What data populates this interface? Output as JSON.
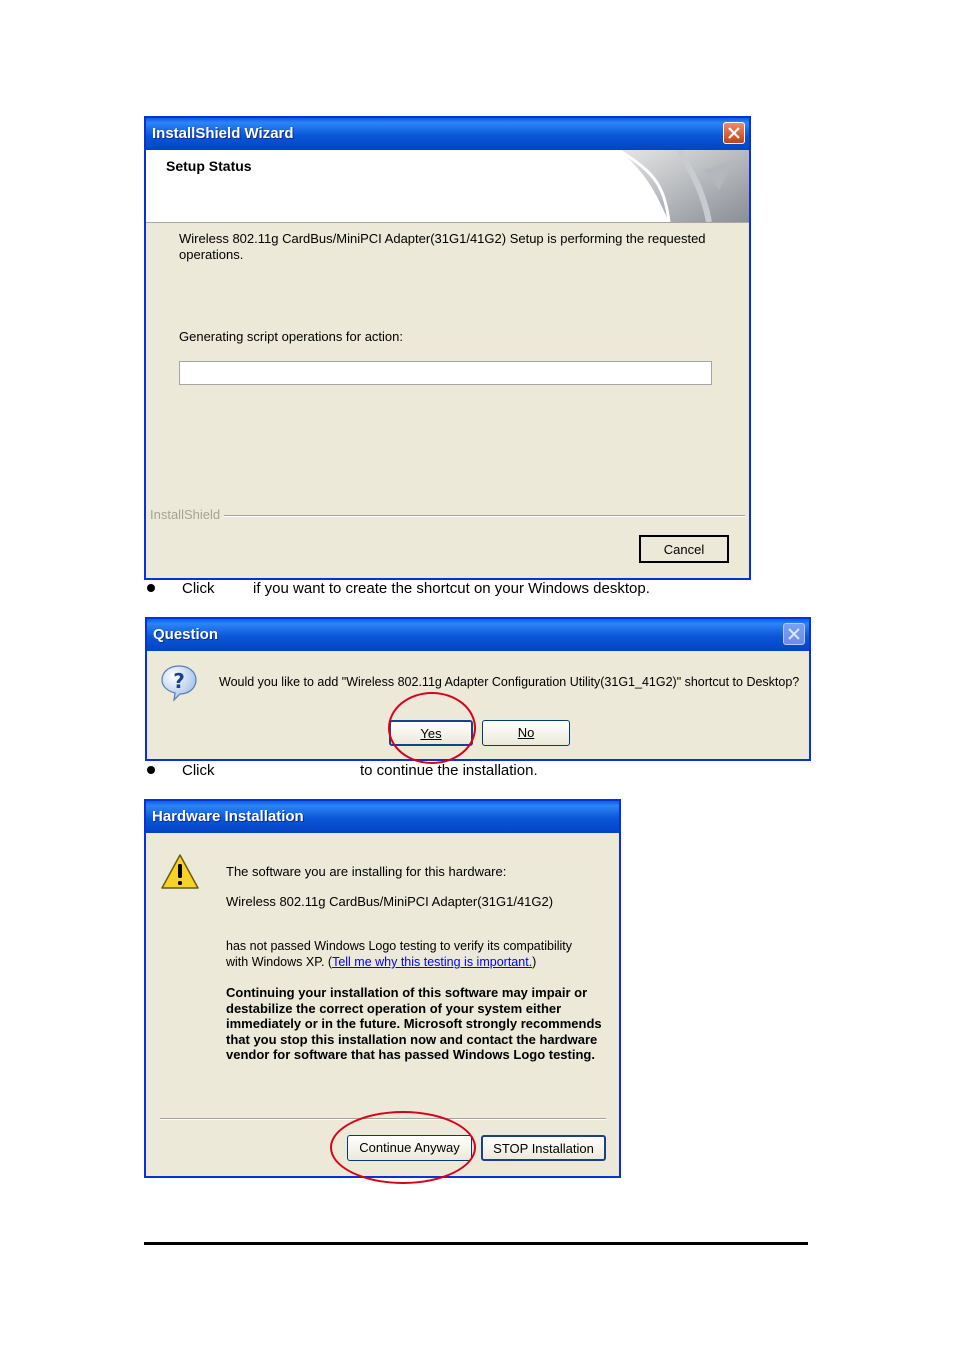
{
  "installshield": {
    "title": "InstallShield Wizard",
    "header_title": "Setup Status",
    "message": "Wireless 802.11g CardBus/MiniPCI Adapter(31G1/41G2) Setup is performing the requested operations.",
    "status_label": "Generating script operations for action:",
    "progress": 0,
    "brand": "InstallShield",
    "cancel_label": "Cancel"
  },
  "step1": {
    "prefix": "Click",
    "text": "if you want to create the shortcut on your Windows desktop."
  },
  "question": {
    "title": "Question",
    "message": "Would you like to add \"Wireless 802.11g Adapter Configuration Utility(31G1_41G2)\" shortcut to Desktop?",
    "yes_label": "Yes",
    "no_label": "No"
  },
  "step2": {
    "prefix": "Click",
    "text": "to continue the installation."
  },
  "hardware": {
    "title": "Hardware Installation",
    "line1": "The software you are installing for this hardware:",
    "device": "Wireless 802.11g CardBus/MiniPCI Adapter(31G1/41G2)",
    "line2a": "has not passed Windows Logo testing to verify its compatibility",
    "line2b": "with Windows XP. (",
    "link": "Tell me why this testing is important.",
    "line2c": ")",
    "warning": "Continuing your installation of this software may impair or destabilize the correct operation of your system either immediately or in the future. Microsoft strongly recommends that you stop this installation now and contact the hardware vendor for software that has passed Windows Logo testing.",
    "continue_label": "Continue Anyway",
    "stop_label": "STOP Installation"
  },
  "colors": {
    "titlebar": "#0a56d8",
    "dialog_bg": "#ece9d8",
    "highlight_circle": "#d9001b",
    "link": "#0000ff"
  }
}
